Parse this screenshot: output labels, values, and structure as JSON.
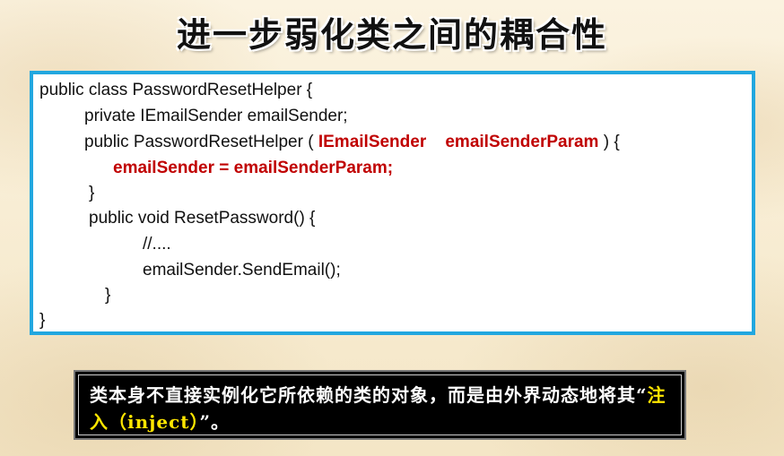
{
  "title": "进一步弱化类之间的耦合性",
  "code": {
    "line1": "public class PasswordResetHelper {",
    "line2": "private IEmailSender emailSender;",
    "line3_prefix": "public PasswordResetHelper ( ",
    "line3_param_type": "IEmailSender",
    "line3_param_name": "emailSenderParam",
    "line3_suffix": " ) {",
    "line4": "emailSender = emailSenderParam;",
    "line5": "}",
    "line6": "public void ResetPassword() {",
    "line7": "//....",
    "line8": "emailSender.SendEmail();",
    "line9": "}",
    "line10": "}"
  },
  "note": {
    "text_part1": "类本身不直接实例化它所依赖的类的对象，而是由外界动态地将其“",
    "highlight": "注入（inject）",
    "text_part2": "”。"
  },
  "colors": {
    "border": "#22a7df",
    "code_highlight": "#c00000",
    "note_highlight": "#ffe600"
  }
}
